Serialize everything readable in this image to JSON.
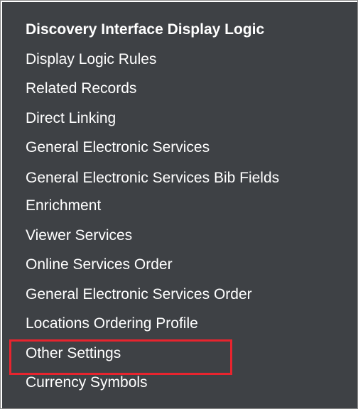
{
  "menu": {
    "items": [
      {
        "label": "Discovery Interface Display Logic",
        "bold": true
      },
      {
        "label": "Display Logic Rules"
      },
      {
        "label": "Related Records"
      },
      {
        "label": "Direct Linking"
      },
      {
        "label": "General Electronic Services"
      },
      {
        "label": "General Electronic Services Bib Fields Enrichment"
      },
      {
        "label": "Viewer Services"
      },
      {
        "label": "Online Services Order"
      },
      {
        "label": "General Electronic Services Order"
      },
      {
        "label": "Locations Ordering Profile"
      },
      {
        "label": "Other Settings",
        "highlighted": true
      },
      {
        "label": "Currency Symbols"
      }
    ]
  },
  "colors": {
    "panel_background": "#3e4145",
    "text": "#ffffff",
    "highlight_border": "#e8242e"
  }
}
